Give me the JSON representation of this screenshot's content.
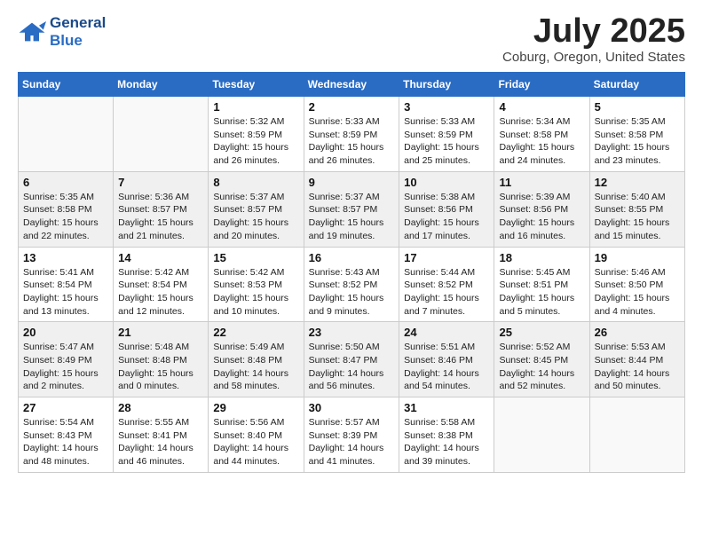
{
  "logo": {
    "line1": "General",
    "line2": "Blue"
  },
  "title": "July 2025",
  "location": "Coburg, Oregon, United States",
  "days_of_week": [
    "Sunday",
    "Monday",
    "Tuesday",
    "Wednesday",
    "Thursday",
    "Friday",
    "Saturday"
  ],
  "weeks": [
    [
      {
        "day": "",
        "info": ""
      },
      {
        "day": "",
        "info": ""
      },
      {
        "day": "1",
        "info": "Sunrise: 5:32 AM\nSunset: 8:59 PM\nDaylight: 15 hours and 26 minutes."
      },
      {
        "day": "2",
        "info": "Sunrise: 5:33 AM\nSunset: 8:59 PM\nDaylight: 15 hours and 26 minutes."
      },
      {
        "day": "3",
        "info": "Sunrise: 5:33 AM\nSunset: 8:59 PM\nDaylight: 15 hours and 25 minutes."
      },
      {
        "day": "4",
        "info": "Sunrise: 5:34 AM\nSunset: 8:58 PM\nDaylight: 15 hours and 24 minutes."
      },
      {
        "day": "5",
        "info": "Sunrise: 5:35 AM\nSunset: 8:58 PM\nDaylight: 15 hours and 23 minutes."
      }
    ],
    [
      {
        "day": "6",
        "info": "Sunrise: 5:35 AM\nSunset: 8:58 PM\nDaylight: 15 hours and 22 minutes."
      },
      {
        "day": "7",
        "info": "Sunrise: 5:36 AM\nSunset: 8:57 PM\nDaylight: 15 hours and 21 minutes."
      },
      {
        "day": "8",
        "info": "Sunrise: 5:37 AM\nSunset: 8:57 PM\nDaylight: 15 hours and 20 minutes."
      },
      {
        "day": "9",
        "info": "Sunrise: 5:37 AM\nSunset: 8:57 PM\nDaylight: 15 hours and 19 minutes."
      },
      {
        "day": "10",
        "info": "Sunrise: 5:38 AM\nSunset: 8:56 PM\nDaylight: 15 hours and 17 minutes."
      },
      {
        "day": "11",
        "info": "Sunrise: 5:39 AM\nSunset: 8:56 PM\nDaylight: 15 hours and 16 minutes."
      },
      {
        "day": "12",
        "info": "Sunrise: 5:40 AM\nSunset: 8:55 PM\nDaylight: 15 hours and 15 minutes."
      }
    ],
    [
      {
        "day": "13",
        "info": "Sunrise: 5:41 AM\nSunset: 8:54 PM\nDaylight: 15 hours and 13 minutes."
      },
      {
        "day": "14",
        "info": "Sunrise: 5:42 AM\nSunset: 8:54 PM\nDaylight: 15 hours and 12 minutes."
      },
      {
        "day": "15",
        "info": "Sunrise: 5:42 AM\nSunset: 8:53 PM\nDaylight: 15 hours and 10 minutes."
      },
      {
        "day": "16",
        "info": "Sunrise: 5:43 AM\nSunset: 8:52 PM\nDaylight: 15 hours and 9 minutes."
      },
      {
        "day": "17",
        "info": "Sunrise: 5:44 AM\nSunset: 8:52 PM\nDaylight: 15 hours and 7 minutes."
      },
      {
        "day": "18",
        "info": "Sunrise: 5:45 AM\nSunset: 8:51 PM\nDaylight: 15 hours and 5 minutes."
      },
      {
        "day": "19",
        "info": "Sunrise: 5:46 AM\nSunset: 8:50 PM\nDaylight: 15 hours and 4 minutes."
      }
    ],
    [
      {
        "day": "20",
        "info": "Sunrise: 5:47 AM\nSunset: 8:49 PM\nDaylight: 15 hours and 2 minutes."
      },
      {
        "day": "21",
        "info": "Sunrise: 5:48 AM\nSunset: 8:48 PM\nDaylight: 15 hours and 0 minutes."
      },
      {
        "day": "22",
        "info": "Sunrise: 5:49 AM\nSunset: 8:48 PM\nDaylight: 14 hours and 58 minutes."
      },
      {
        "day": "23",
        "info": "Sunrise: 5:50 AM\nSunset: 8:47 PM\nDaylight: 14 hours and 56 minutes."
      },
      {
        "day": "24",
        "info": "Sunrise: 5:51 AM\nSunset: 8:46 PM\nDaylight: 14 hours and 54 minutes."
      },
      {
        "day": "25",
        "info": "Sunrise: 5:52 AM\nSunset: 8:45 PM\nDaylight: 14 hours and 52 minutes."
      },
      {
        "day": "26",
        "info": "Sunrise: 5:53 AM\nSunset: 8:44 PM\nDaylight: 14 hours and 50 minutes."
      }
    ],
    [
      {
        "day": "27",
        "info": "Sunrise: 5:54 AM\nSunset: 8:43 PM\nDaylight: 14 hours and 48 minutes."
      },
      {
        "day": "28",
        "info": "Sunrise: 5:55 AM\nSunset: 8:41 PM\nDaylight: 14 hours and 46 minutes."
      },
      {
        "day": "29",
        "info": "Sunrise: 5:56 AM\nSunset: 8:40 PM\nDaylight: 14 hours and 44 minutes."
      },
      {
        "day": "30",
        "info": "Sunrise: 5:57 AM\nSunset: 8:39 PM\nDaylight: 14 hours and 41 minutes."
      },
      {
        "day": "31",
        "info": "Sunrise: 5:58 AM\nSunset: 8:38 PM\nDaylight: 14 hours and 39 minutes."
      },
      {
        "day": "",
        "info": ""
      },
      {
        "day": "",
        "info": ""
      }
    ]
  ]
}
